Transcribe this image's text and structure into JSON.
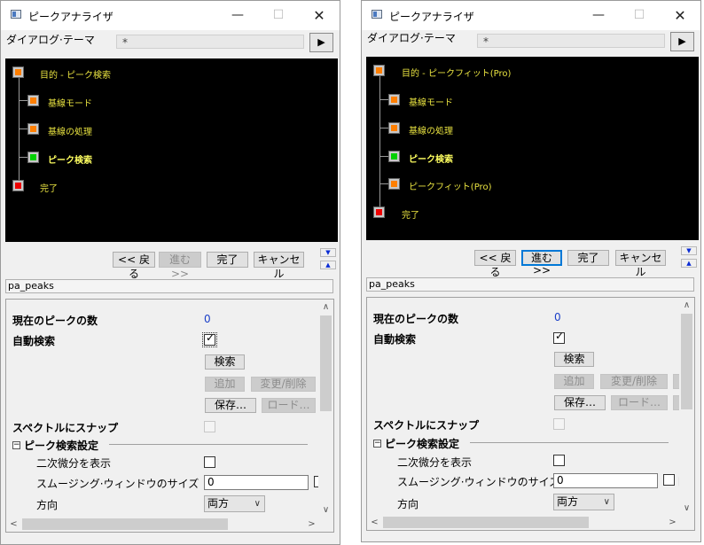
{
  "title": "ピークアナライザ",
  "caption_buttons": {
    "minimize": "—",
    "maximize": "☐",
    "close": "✕"
  },
  "dialog_theme": {
    "label": "ダイアログ·テーマ",
    "value": "*",
    "arrow": "▶"
  },
  "sheet_name": "pa_peaks",
  "nav": {
    "back": "<< 戻る",
    "next": "進む >>",
    "finish": "完了",
    "cancel": "キャンセル"
  },
  "arrows": {
    "down": "▼",
    "up": "▲"
  },
  "props": {
    "peak_count_label": "現在のピークの数",
    "peak_count_value": "0",
    "auto_find_label": "自動検索",
    "find_button": "検索",
    "add_button": "追加",
    "modify_button": "変更/削除",
    "save_button": "保存…",
    "load_button": "ロード…",
    "snap_label": "スペクトルにスナップ",
    "section_title": "ピーク検索設定",
    "collapse_symbol": "−",
    "show_2nd_deriv_label": "二次微分を表示",
    "smoothing_label": "スムージング·ウィンドウのサイズ",
    "smoothing_value": "0",
    "direction_label": "方向",
    "direction_value": "両方",
    "cut_char": "自"
  },
  "scroll_symbols": {
    "up": "∧",
    "down": "∨",
    "left": "<",
    "right": ">"
  },
  "left_tree": [
    {
      "label": "目的 - ピーク検索",
      "color": "#ff7f00"
    },
    {
      "label": "基線モード",
      "color": "#ff7f00"
    },
    {
      "label": "基線の処理",
      "color": "#ff7f00"
    },
    {
      "label": "ピーク検索",
      "color": "#00d000",
      "current": true
    },
    {
      "label": "完了",
      "color": "#ee0000"
    }
  ],
  "right_tree": [
    {
      "label": "目的 - ピークフィット(Pro)",
      "color": "#ff7f00"
    },
    {
      "label": "基線モード",
      "color": "#ff7f00"
    },
    {
      "label": "基線の処理",
      "color": "#ff7f00"
    },
    {
      "label": "ピーク検索",
      "color": "#00d000",
      "current": true
    },
    {
      "label": "ピークフィット(Pro)",
      "color": "#ff7f00"
    },
    {
      "label": "完了",
      "color": "#ee0000"
    }
  ]
}
